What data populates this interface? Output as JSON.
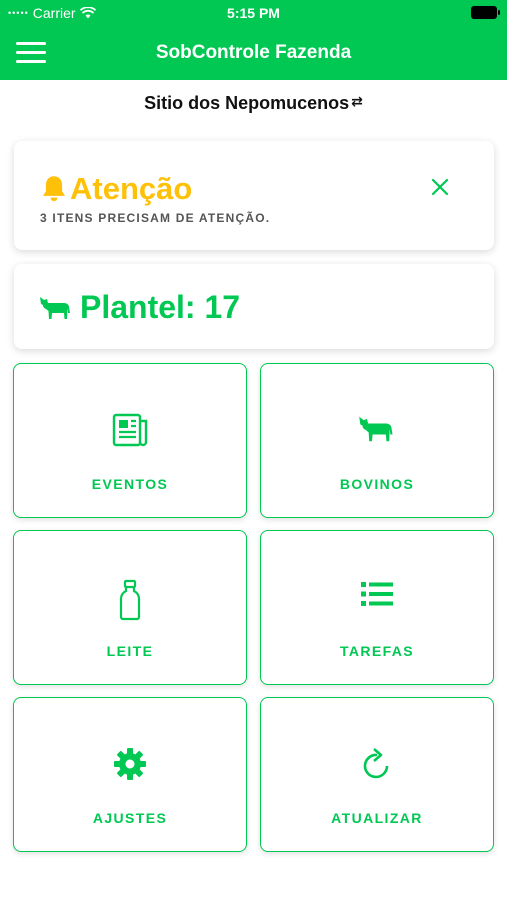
{
  "status_bar": {
    "carrier": "Carrier",
    "time": "5:15 PM"
  },
  "app_bar": {
    "title": "SobControle Fazenda"
  },
  "farm": {
    "name": "Sitio dos Nepomucenos",
    "swap_icon": "swap-icon"
  },
  "alert": {
    "title": "Atenção",
    "subtitle": "3 ITENS PRECISAM DE ATENÇÃO.",
    "color": "#ffc107"
  },
  "herd": {
    "label": "Plantel: 17"
  },
  "tiles": [
    {
      "label": "EVENTOS",
      "icon": "newspaper-icon"
    },
    {
      "label": "BOVINOS",
      "icon": "cow-icon"
    },
    {
      "label": "LEITE",
      "icon": "bottle-icon"
    },
    {
      "label": "TAREFAS",
      "icon": "list-icon"
    },
    {
      "label": "AJUSTES",
      "icon": "gear-icon"
    },
    {
      "label": "ATUALIZAR",
      "icon": "refresh-icon"
    }
  ],
  "colors": {
    "primary": "#00c853",
    "warning": "#ffc107"
  }
}
